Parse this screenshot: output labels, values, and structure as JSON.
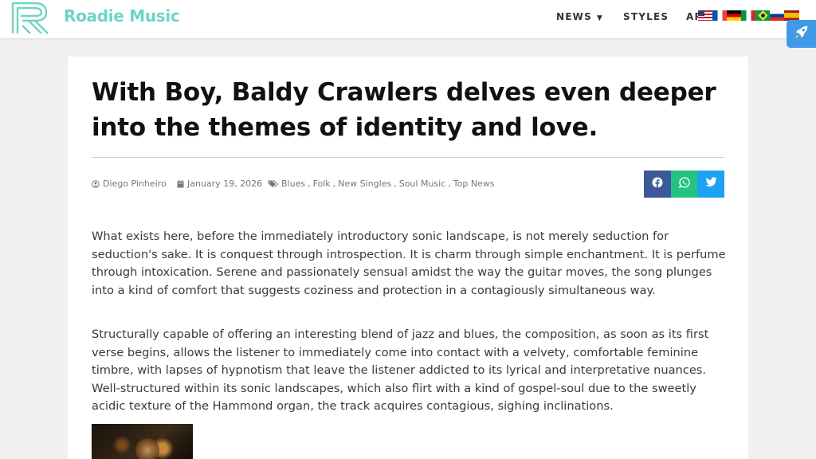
{
  "header": {
    "brand": "Roadie Music",
    "nav": {
      "news": "NEWS",
      "styles": "STYLES",
      "arts": "ARTS"
    },
    "flags": [
      "us-flag",
      "fr-flag",
      "de-flag",
      "it-flag",
      "br-flag",
      "ru-flag",
      "es-flag"
    ]
  },
  "article": {
    "title": "With Boy, Baldy Crawlers delves even deeper into the themes of identity and love.",
    "author": "Diego Pinheiro",
    "date": "January 19, 2026",
    "tags": [
      "Blues",
      "Folk",
      "New Singles",
      "Soul Music",
      "Top News"
    ],
    "paragraphs": [
      "What exists here, before the immediately introductory sonic landscape, is not merely seduction for seduction's sake. It is conquest through introspection. It is charm through simple enchantment. It is perfume through intoxication. Serene and passionately sensual amidst the way the guitar moves, the song plunges into a kind of comfort that suggests coziness and protection in a contagiously simultaneous way.",
      "Structurally capable of offering an interesting blend of jazz and blues, the composition, as soon as its first verse begins, allows the listener to immediately come into contact with a velvety, comfortable feminine timbre, with lapses of hypnotism that leave the listener addicted to its lyrical and interpretative nuances. Well-structured within its sonic landscapes, which also flirt with a kind of gospel-soul due to the sweetly acidic texture of the Hammond organ, the track acquires contagious, sighing inclinations."
    ]
  },
  "colors": {
    "brand": "#6fd4c4",
    "facebook": "#3b5998",
    "whatsapp": "#26c281",
    "twitter": "#1da1f2",
    "rocket": "#3f9ae8"
  }
}
